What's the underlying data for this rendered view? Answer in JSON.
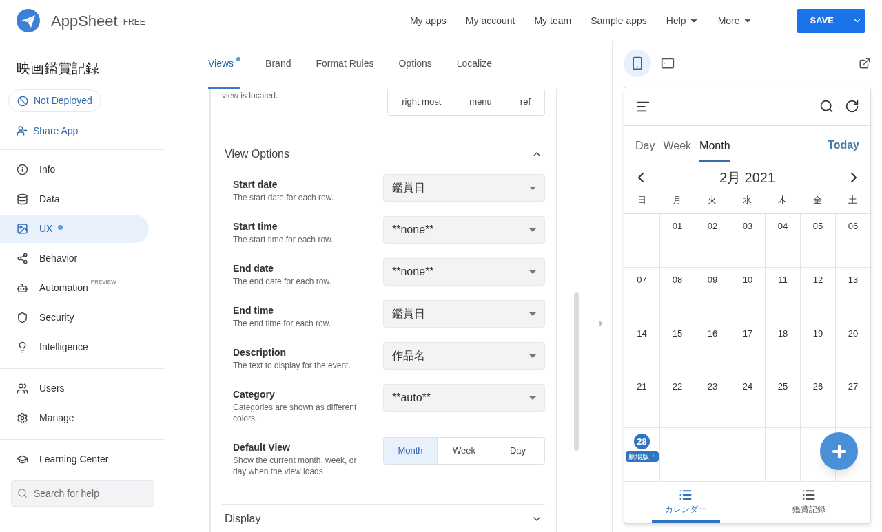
{
  "brand": {
    "name": "AppSheet",
    "plan": "FREE"
  },
  "top_nav": [
    {
      "label": "My apps",
      "dropdown": false
    },
    {
      "label": "My account",
      "dropdown": false
    },
    {
      "label": "My team",
      "dropdown": false
    },
    {
      "label": "Sample apps",
      "dropdown": false
    },
    {
      "label": "Help",
      "dropdown": true
    },
    {
      "label": "More",
      "dropdown": true
    }
  ],
  "save_button": "SAVE",
  "sidebar": {
    "app_title": "映画鑑賞記録",
    "status": "Not Deployed",
    "share": "Share App",
    "groups": [
      [
        {
          "label": "Info",
          "selected": false
        },
        {
          "label": "Data",
          "selected": false
        },
        {
          "label": "UX",
          "selected": true,
          "dot": true
        },
        {
          "label": "Behavior",
          "selected": false
        },
        {
          "label": "Automation",
          "selected": false,
          "badge": "PREVIEW"
        },
        {
          "label": "Security",
          "selected": false
        },
        {
          "label": "Intelligence",
          "selected": false
        }
      ],
      [
        {
          "label": "Users",
          "selected": false
        },
        {
          "label": "Manage",
          "selected": false
        }
      ],
      [
        {
          "label": "Learning Center",
          "selected": false
        }
      ]
    ],
    "search": {
      "placeholder": "Search for help"
    }
  },
  "tabs": [
    {
      "label": "Views",
      "selected": true,
      "dot": true
    },
    {
      "label": "Brand",
      "selected": false
    },
    {
      "label": "Format Rules",
      "selected": false
    },
    {
      "label": "Options",
      "selected": false
    },
    {
      "label": "Localize",
      "selected": false
    }
  ],
  "position": {
    "hint": "view is located.",
    "options": [
      {
        "label": "right most",
        "selected": false
      },
      {
        "label": "menu",
        "selected": false
      },
      {
        "label": "ref",
        "selected": false
      }
    ]
  },
  "view_options": {
    "title": "View Options",
    "expanded": true,
    "fields": [
      {
        "kind": "select",
        "label": "Start date",
        "hint": "The start date for each row.",
        "value": "鑑賞日"
      },
      {
        "kind": "select",
        "label": "Start time",
        "hint": "The start time for each row.",
        "value": "**none**"
      },
      {
        "kind": "select",
        "label": "End date",
        "hint": "The end date for each row.",
        "value": "**none**"
      },
      {
        "kind": "select",
        "label": "End time",
        "hint": "The end time for each row.",
        "value": "鑑賞日"
      },
      {
        "kind": "select",
        "label": "Description",
        "hint": "The text to display for the event.",
        "value": "作品名"
      },
      {
        "kind": "select",
        "label": "Category",
        "hint": "Categories are shown as different colors.",
        "value": "**auto**"
      },
      {
        "kind": "segmented",
        "label": "Default View",
        "hint": "Show the current month, week, or day when the view loads",
        "options": [
          {
            "label": "Month",
            "selected": true
          },
          {
            "label": "Week",
            "selected": false
          },
          {
            "label": "Day",
            "selected": false
          }
        ]
      }
    ]
  },
  "display_section": {
    "title": "Display",
    "expanded": false
  },
  "preview": {
    "devices": [
      {
        "selected": true
      },
      {
        "selected": false
      }
    ],
    "calendar": {
      "modes": [
        {
          "label": "Day",
          "selected": false
        },
        {
          "label": "Week",
          "selected": false
        },
        {
          "label": "Month",
          "selected": true
        }
      ],
      "today": "Today",
      "month": "2月 2021",
      "weekdays": [
        "日",
        "月",
        "火",
        "水",
        "木",
        "金",
        "土"
      ],
      "weeks": [
        [
          {
            "kind": "blank"
          },
          {
            "kind": "date",
            "date": "01",
            "today": false
          },
          {
            "kind": "date",
            "date": "02",
            "today": false
          },
          {
            "kind": "date",
            "date": "03",
            "today": false
          },
          {
            "kind": "date",
            "date": "04",
            "today": false
          },
          {
            "kind": "date",
            "date": "05",
            "today": false
          },
          {
            "kind": "date",
            "date": "06",
            "today": false
          }
        ],
        [
          {
            "kind": "date",
            "date": "07",
            "today": false
          },
          {
            "kind": "date",
            "date": "08",
            "today": false
          },
          {
            "kind": "date",
            "date": "09",
            "today": false
          },
          {
            "kind": "date",
            "date": "10",
            "today": false
          },
          {
            "kind": "date",
            "date": "11",
            "today": false
          },
          {
            "kind": "date",
            "date": "12",
            "today": false
          },
          {
            "kind": "date",
            "date": "13",
            "today": false
          }
        ],
        [
          {
            "kind": "date",
            "date": "14",
            "today": false
          },
          {
            "kind": "date",
            "date": "15",
            "today": false
          },
          {
            "kind": "date",
            "date": "16",
            "today": false
          },
          {
            "kind": "date",
            "date": "17",
            "today": false
          },
          {
            "kind": "date",
            "date": "18",
            "today": false
          },
          {
            "kind": "date",
            "date": "19",
            "today": false
          },
          {
            "kind": "date",
            "date": "20",
            "today": false
          }
        ],
        [
          {
            "kind": "date",
            "date": "21",
            "today": false
          },
          {
            "kind": "date",
            "date": "22",
            "today": false
          },
          {
            "kind": "date",
            "date": "23",
            "today": false
          },
          {
            "kind": "date",
            "date": "24",
            "today": false
          },
          {
            "kind": "date",
            "date": "25",
            "today": false
          },
          {
            "kind": "date",
            "date": "26",
            "today": false
          },
          {
            "kind": "date",
            "date": "27",
            "today": false
          }
        ],
        [
          {
            "kind": "date",
            "date": "28",
            "today": true,
            "events": [
              "劇場版「"
            ]
          },
          {
            "kind": "blank"
          },
          {
            "kind": "blank"
          },
          {
            "kind": "blank"
          },
          {
            "kind": "blank"
          },
          {
            "kind": "blank"
          },
          {
            "kind": "blank"
          }
        ]
      ]
    },
    "bottom_nav": [
      {
        "label": "カレンダー",
        "selected": true
      },
      {
        "label": "鑑賞記録",
        "selected": false
      }
    ]
  }
}
